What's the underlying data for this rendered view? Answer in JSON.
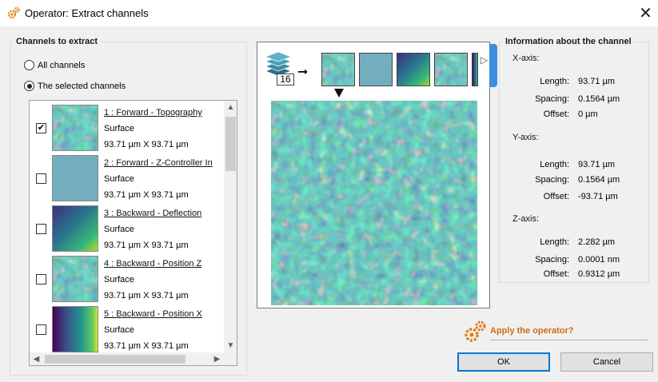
{
  "window": {
    "title": "Operator: Extract channels",
    "close_icon": "close-icon"
  },
  "channels_group": {
    "title": "Channels to extract",
    "options": [
      {
        "label": "All channels",
        "selected": false
      },
      {
        "label": "The selected channels",
        "selected": true
      }
    ],
    "items": [
      {
        "name": "1 : Forward - Topography",
        "type": "Surface",
        "size": "93.71 µm X 93.71 µm",
        "checked": true,
        "check_mark": "✔",
        "thumb": "texture"
      },
      {
        "name": "2 : Forward - Z-Controller In",
        "type": "Surface",
        "size": "93.71 µm X 93.71 µm",
        "checked": false,
        "check_mark": "",
        "thumb": "fine"
      },
      {
        "name": "3 : Backward - Deflection",
        "type": "Surface",
        "size": "93.71 µm X 93.71 µm",
        "checked": false,
        "check_mark": "",
        "thumb": "gradient"
      },
      {
        "name": "4 : Backward - Position Z",
        "type": "Surface",
        "size": "93.71 µm X 93.71 µm",
        "checked": false,
        "check_mark": "",
        "thumb": "texture"
      },
      {
        "name": "5 : Backward - Position X",
        "type": "Surface",
        "size": "93.71 µm X 93.71 µm",
        "checked": false,
        "check_mark": "",
        "thumb": "xgradient"
      }
    ]
  },
  "preview": {
    "stack_count": "16",
    "arrow": "➞"
  },
  "info": {
    "title": "Information about the channel",
    "x_axis": {
      "label": "X-axis:",
      "length_key": "Length:",
      "length": "93.71 µm",
      "spacing_key": "Spacing:",
      "spacing": "0.1564 µm",
      "offset_key": "Offset:",
      "offset": "0 µm"
    },
    "y_axis": {
      "label": "Y-axis:",
      "length_key": "Length:",
      "length": "93.71 µm",
      "spacing_key": "Spacing:",
      "spacing": "0.1564 µm",
      "offset_key": "Offset:",
      "offset": "-93.71 µm"
    },
    "z_axis": {
      "label": "Z-axis:",
      "length_key": "Length:",
      "length": "2.282 µm",
      "spacing_key": "Spacing:",
      "spacing": "0.0001 nm",
      "offset_key": "Offset:",
      "offset": "0.9312 µm"
    }
  },
  "apply": {
    "label": "Apply the operator?",
    "icon": "gears-icon"
  },
  "buttons": {
    "ok": "OK",
    "cancel": "Cancel"
  },
  "colors": {
    "accent_orange": "#d06a14",
    "viridis_dark": "#2b3a7a",
    "viridis_mid": "#21918c",
    "viridis_light": "#fde725",
    "focus_blue": "#0078d7"
  }
}
